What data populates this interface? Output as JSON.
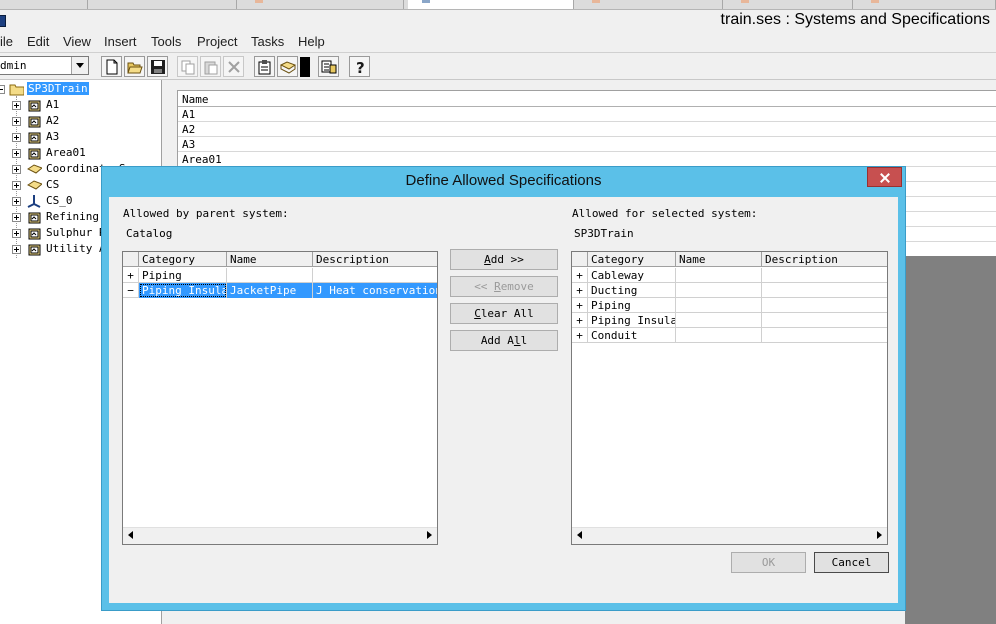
{
  "window": {
    "title": "train.ses : Systems and Specifications"
  },
  "menu": [
    "ile",
    "Edit",
    "View",
    "Insert",
    "Tools",
    "Project",
    "Tasks",
    "Help"
  ],
  "toolbar": {
    "user_combo_value": "dmin"
  },
  "tree": {
    "root": "SP3DTrain",
    "items": [
      "A1",
      "A2",
      "A3",
      "Area01",
      "Coordinate Sy",
      "CS",
      "CS_0",
      "Refining",
      "Sulphur R",
      "Utility A"
    ]
  },
  "list": {
    "header": "Name",
    "rows": [
      "A1",
      "A2",
      "A3",
      "Area01"
    ]
  },
  "dialog": {
    "title": "Define Allowed Specifications",
    "allowed_by_parent_label": "Allowed by parent system:",
    "allowed_by_parent_value": "Catalog",
    "allowed_for_selected_label": "Allowed for selected system:",
    "allowed_for_selected_value": "SP3DTrain",
    "columns": [
      "Category",
      "Name",
      "Description"
    ],
    "left_rows": [
      {
        "toggle": "+",
        "category": "Piping",
        "name": "",
        "description": ""
      },
      {
        "toggle": "−",
        "category": "Piping Insulation",
        "name": "JacketPipe",
        "description": "J Heat conservation",
        "selected": true
      }
    ],
    "right_rows": [
      {
        "toggle": "+",
        "category": "Cableway",
        "name": "",
        "description": ""
      },
      {
        "toggle": "+",
        "category": "Ducting",
        "name": "",
        "description": ""
      },
      {
        "toggle": "+",
        "category": "Piping",
        "name": "",
        "description": ""
      },
      {
        "toggle": "+",
        "category": "Piping Insulation",
        "name": "",
        "description": ""
      },
      {
        "toggle": "+",
        "category": "Conduit",
        "name": "",
        "description": ""
      }
    ],
    "buttons": {
      "add_pre": "",
      "add_key": "A",
      "add_post": "dd >>",
      "remove_pre": "<< ",
      "remove_key": "R",
      "remove_post": "emove",
      "clear_pre": "",
      "clear_key": "C",
      "clear_post": "lear All",
      "addall_pre": "Add A",
      "addall_key": "l",
      "addall_post": "l",
      "ok": "OK",
      "cancel": "Cancel"
    }
  }
}
